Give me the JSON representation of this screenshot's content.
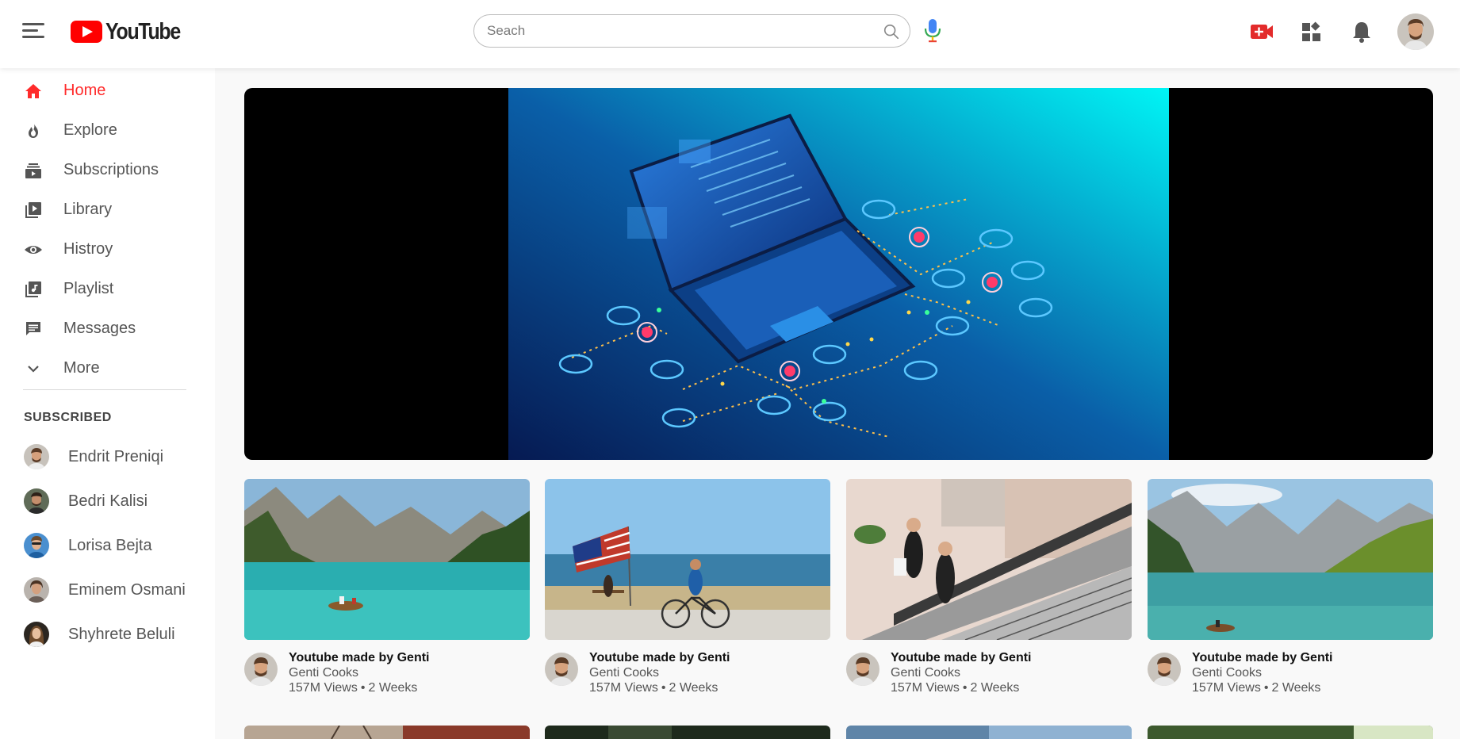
{
  "app": {
    "logo_text": "YouTube",
    "accent": "#ff0000"
  },
  "search": {
    "placeholder": "Seach",
    "value": ""
  },
  "header_icons": [
    "menu-icon",
    "search-icon",
    "microphone-icon",
    "create-video-icon",
    "apps-icon",
    "notifications-bell-icon",
    "user-avatar"
  ],
  "sidebar": {
    "items": [
      {
        "label": "Home",
        "icon": "home-icon",
        "active": true
      },
      {
        "label": "Explore",
        "icon": "flame-icon",
        "active": false
      },
      {
        "label": "Subscriptions",
        "icon": "subscriptions-icon",
        "active": false
      },
      {
        "label": "Library",
        "icon": "library-icon",
        "active": false
      },
      {
        "label": "Histroy",
        "icon": "eye-icon",
        "active": false
      },
      {
        "label": "Playlist",
        "icon": "playlist-icon",
        "active": false
      },
      {
        "label": "Messages",
        "icon": "chat-icon",
        "active": false
      },
      {
        "label": "More",
        "icon": "chevron-down-icon",
        "active": false
      }
    ],
    "subscribed_heading": "SUBSCRIBED",
    "subscriptions": [
      {
        "name": "Endrit Preniqi"
      },
      {
        "name": "Bedri Kalisi"
      },
      {
        "name": "Lorisa Bejta"
      },
      {
        "name": "Eminem Osmani"
      },
      {
        "name": "Shyhrete Beluli"
      }
    ]
  },
  "videos": [
    {
      "title": "Youtube made by Genti",
      "channel": "Genti Cooks",
      "views": "157M Views",
      "age": "2 Weeks",
      "thumb": "mountain-lake-boat"
    },
    {
      "title": "Youtube made by Genti",
      "channel": "Genti Cooks",
      "views": "157M Views",
      "age": "2 Weeks",
      "thumb": "beach-flag-bicycle"
    },
    {
      "title": "Youtube made by Genti",
      "channel": "Genti Cooks",
      "views": "157M Views",
      "age": "2 Weeks",
      "thumb": "mall-escalator"
    },
    {
      "title": "Youtube made by Genti",
      "channel": "Genti Cooks",
      "views": "157M Views",
      "age": "2 Weeks",
      "thumb": "alpine-lake-boat"
    }
  ],
  "meta_separator": "•"
}
